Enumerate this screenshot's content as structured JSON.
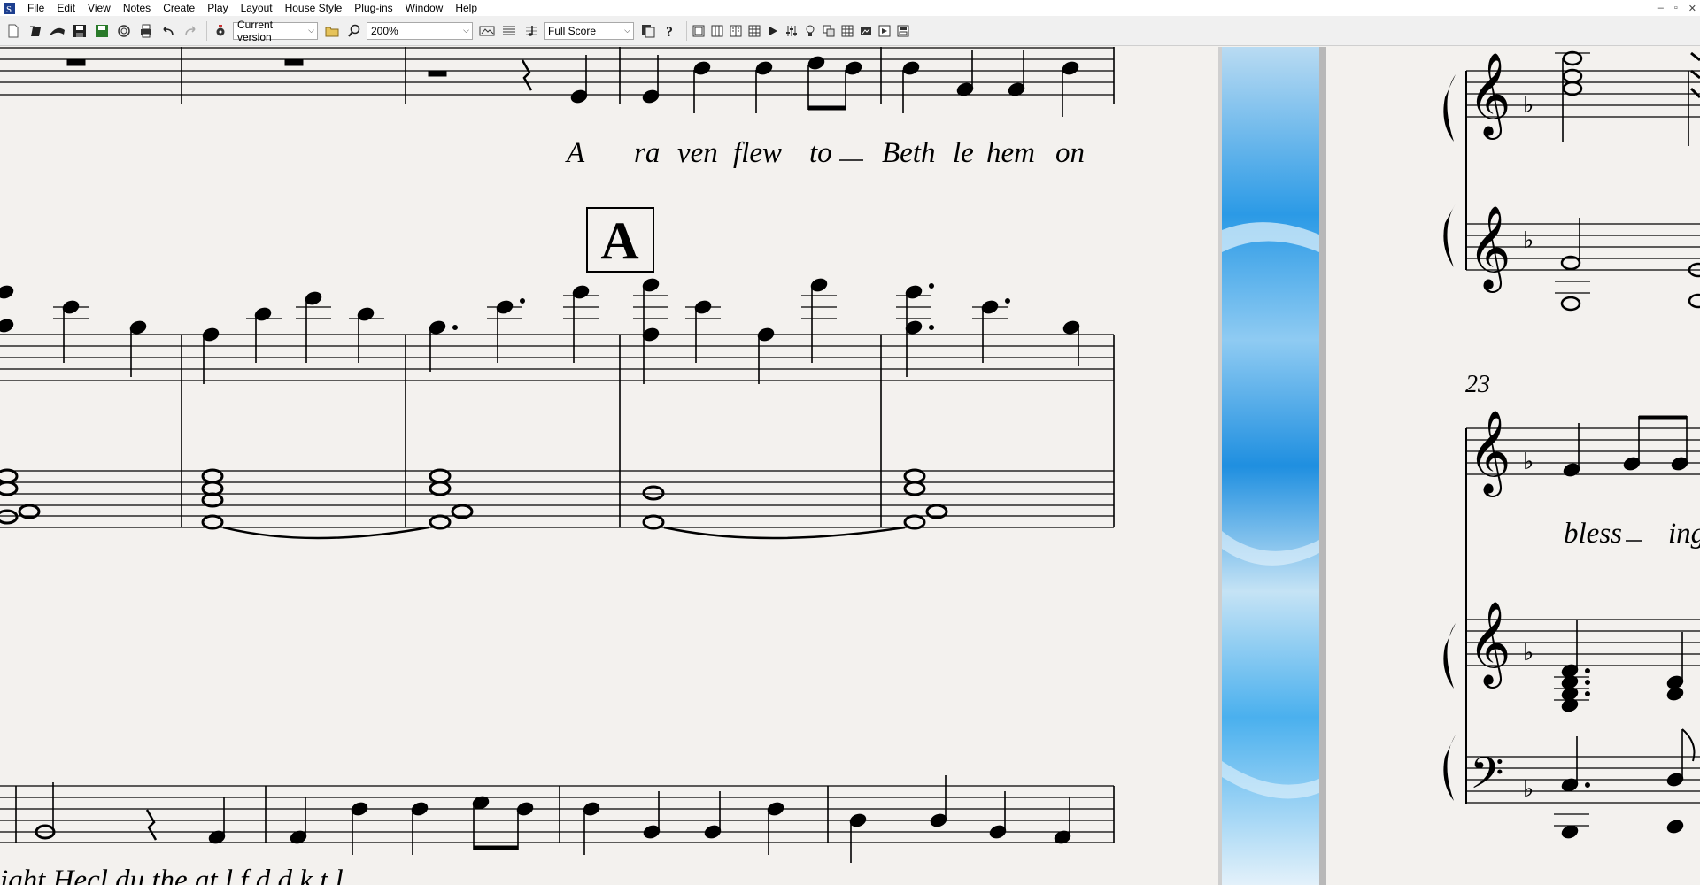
{
  "menu": {
    "items": [
      "File",
      "Edit",
      "View",
      "Notes",
      "Create",
      "Play",
      "Layout",
      "House Style",
      "Plug-ins",
      "Window",
      "Help"
    ]
  },
  "toolbar": {
    "version_select": "Current version",
    "zoom_select": "200%",
    "score_view_select": "Full Score"
  },
  "window_controls": {
    "minimize": "–",
    "restore": "▫",
    "close": "✕"
  },
  "score": {
    "lyrics_line1": [
      "A",
      "ra",
      "ven",
      "flew",
      "to",
      "Beth",
      "le",
      "hem",
      "on"
    ],
    "rehearsal_mark": "A",
    "bar_number": "23",
    "lyrics_right": [
      "bless",
      "ing"
    ],
    "lyrics_bottom_partial": "ight    Hecl  du    the  at  l   f  d   d  k   t  l"
  },
  "colors": {
    "paper": "#f3f1ee",
    "ink": "#000000",
    "divider_blue": "#3aa0e8"
  }
}
